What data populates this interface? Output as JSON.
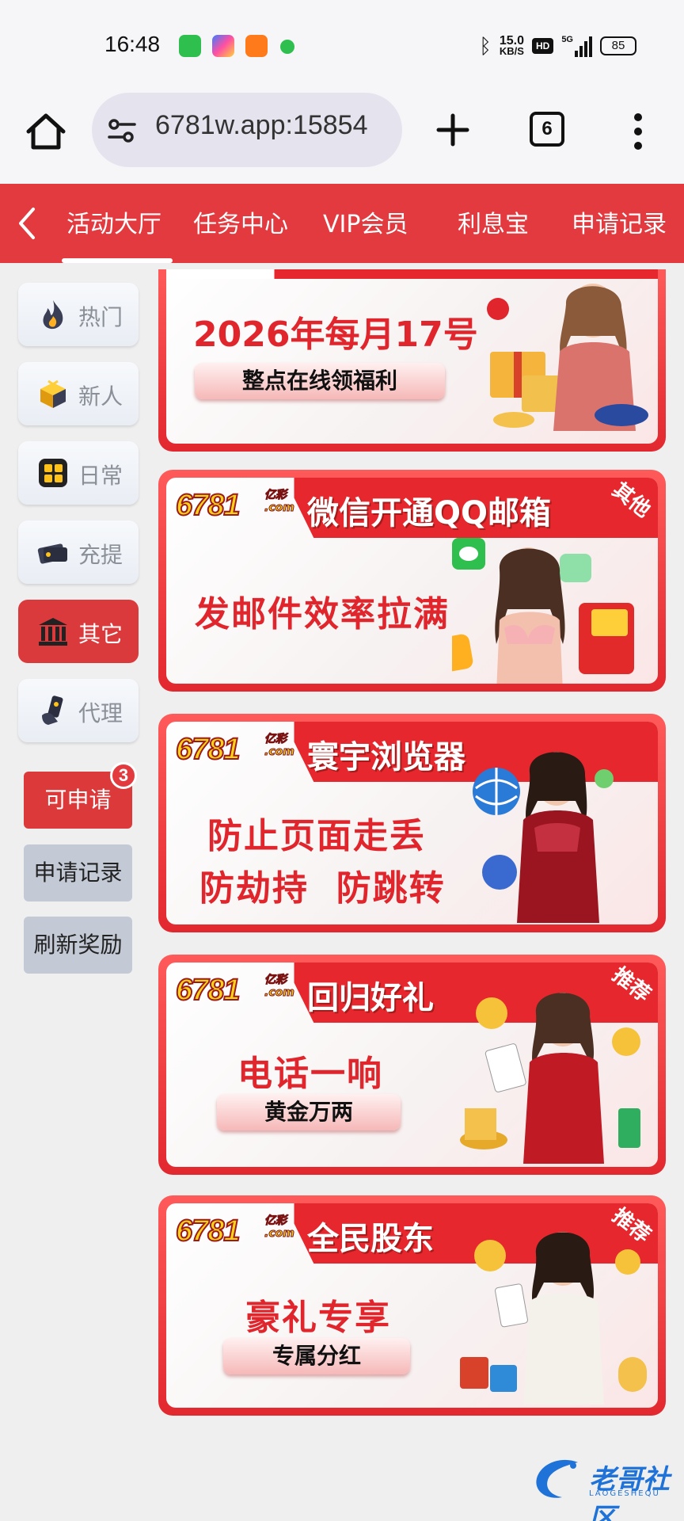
{
  "status_bar": {
    "time": "16:48",
    "net_speed": "15.0",
    "net_unit": "KB/S",
    "hd": "HD",
    "signal": "5G",
    "battery": "85"
  },
  "browser": {
    "url": "6781w.app:15854",
    "tab_count": "6"
  },
  "tabs": [
    {
      "label": "活动大厅"
    },
    {
      "label": "任务中心"
    },
    {
      "label": "VIP会员"
    },
    {
      "label": "利息宝"
    },
    {
      "label": "申请记录"
    }
  ],
  "sidebar": {
    "categories": [
      {
        "label": "热门",
        "icon": "flame-icon"
      },
      {
        "label": "新人",
        "icon": "gift-box-icon"
      },
      {
        "label": "日常",
        "icon": "calendar-icon"
      },
      {
        "label": "充提",
        "icon": "wallet-icon"
      },
      {
        "label": "其它",
        "icon": "bank-icon"
      },
      {
        "label": "代理",
        "icon": "phone-hand-icon"
      }
    ],
    "actions": {
      "apply": "可申请",
      "apply_badge": "3",
      "records": "申请记录",
      "refresh": "刷新奖励"
    }
  },
  "banners": [
    {
      "headline": "2026年每月17号",
      "pill": "整点在线领福利"
    },
    {
      "logo": "6781",
      "logo_sub1": "亿彩",
      "logo_sub2": ".com",
      "title": "微信开通QQ邮箱",
      "tag": "其他",
      "main": "发邮件效率拉满"
    },
    {
      "logo": "6781",
      "logo_sub1": "亿彩",
      "logo_sub2": ".com",
      "title": "寰宇浏览器",
      "main1": "防止页面走丢",
      "main2": "防劫持  防跳转"
    },
    {
      "logo": "6781",
      "logo_sub1": "亿彩",
      "logo_sub2": ".com",
      "title": "回归好礼",
      "tag": "推荐",
      "main": "电话一响",
      "pill": "黄金万两"
    },
    {
      "logo": "6781",
      "logo_sub1": "亿彩",
      "logo_sub2": ".com",
      "title": "全民股东",
      "tag": "推荐",
      "main": "豪礼专享",
      "pill": "专属分红"
    }
  ],
  "watermark": {
    "text": "老哥社区",
    "sub": "LAOGESHEQU"
  },
  "colors": {
    "accent_red": "#e23a3f",
    "sidebar_active": "#db3a3c",
    "banner_text": "#e0262c",
    "logo_yellow": "#ffd21a"
  }
}
